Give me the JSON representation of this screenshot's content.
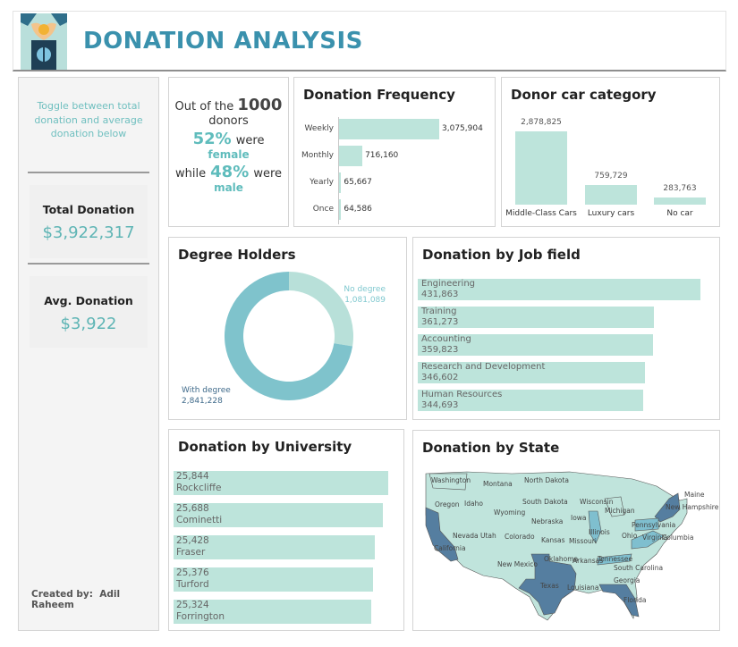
{
  "header": {
    "title": "DONATION ANALYSIS"
  },
  "colors": {
    "teal": "#5fbcbc",
    "bar": "#bde4db",
    "title": "#3a91ad",
    "dark_state": "#557ea0",
    "mid_state": "#7fbfcf"
  },
  "sidebar": {
    "toggle_text": "Toggle between total donation and average donation below",
    "total_label": "Total Donation",
    "total_value": "$3,922,317",
    "avg_label": "Avg. Donation",
    "avg_value": "$3,922",
    "credit_label": "Created by:",
    "credit_name": "Adil Raheem"
  },
  "gender": {
    "line1_prefix": "Out of the",
    "donors_count": "1000",
    "line1_suffix": "donors",
    "female_pct": "52%",
    "were1": "were",
    "female_label": "female",
    "while_label": "while",
    "male_pct": "48%",
    "were2": "were",
    "male_label": "male"
  },
  "frequency": {
    "title": "Donation Frequency",
    "chart_data": {
      "type": "bar",
      "orientation": "horizontal",
      "categories": [
        "Weekly",
        "Monthly",
        "Yearly",
        "Once"
      ],
      "values": [
        3075904,
        716160,
        65667,
        64586
      ],
      "labels": [
        "3,075,904",
        "716,160",
        "65,667",
        "64,586"
      ]
    }
  },
  "car": {
    "title": "Donor car category",
    "chart_data": {
      "type": "bar",
      "categories": [
        "Middle-Class Cars",
        "Luxury cars",
        "No car"
      ],
      "values": [
        2878825,
        759729,
        283763
      ],
      "labels": [
        "2,878,825",
        "759,729",
        "283,763"
      ]
    }
  },
  "degree": {
    "title": "Degree Holders",
    "chart_data": {
      "type": "pie",
      "categories": [
        "No degree",
        "With degree"
      ],
      "values": [
        1081089,
        2841228
      ],
      "labels": [
        "1,081,089",
        "2,841,228"
      ]
    }
  },
  "job": {
    "title": "Donation by Job field",
    "chart_data": {
      "type": "bar",
      "orientation": "horizontal",
      "categories": [
        "Engineering",
        "Training",
        "Accounting",
        "Research and Development",
        "Human Resources"
      ],
      "values": [
        431863,
        361273,
        359823,
        346602,
        344693
      ],
      "labels": [
        "431,863",
        "361,273",
        "359,823",
        "346,602",
        "344,693"
      ]
    }
  },
  "university": {
    "title": "Donation by University",
    "chart_data": {
      "type": "bar",
      "orientation": "horizontal",
      "categories": [
        "Rockcliffe",
        "Cominetti",
        "Fraser",
        "Turford",
        "Forrington"
      ],
      "values": [
        25844,
        25688,
        25428,
        25376,
        25324
      ],
      "labels": [
        "25,844",
        "25,688",
        "25,428",
        "25,376",
        "25,324"
      ]
    }
  },
  "state": {
    "title": "Donation by State",
    "labels": [
      "Washington",
      "Montana",
      "North Dakota",
      "Oregon",
      "Idaho",
      "South Dakota",
      "Wisconsin",
      "Michigan",
      "Wyoming",
      "Iowa",
      "Nebraska",
      "New Hampshire",
      "Maine",
      "Nevada",
      "Utah",
      "Colorado",
      "Kansas",
      "Missouri",
      "Illinois",
      "Pennsylvania",
      "California",
      "Ohio",
      "Virginia",
      "Columbia",
      "Oklahoma",
      "Tennessee",
      "New Mexico",
      "Arkansas",
      "South Carolina",
      "Texas",
      "Louisiana",
      "Georgia",
      "Florida"
    ]
  }
}
